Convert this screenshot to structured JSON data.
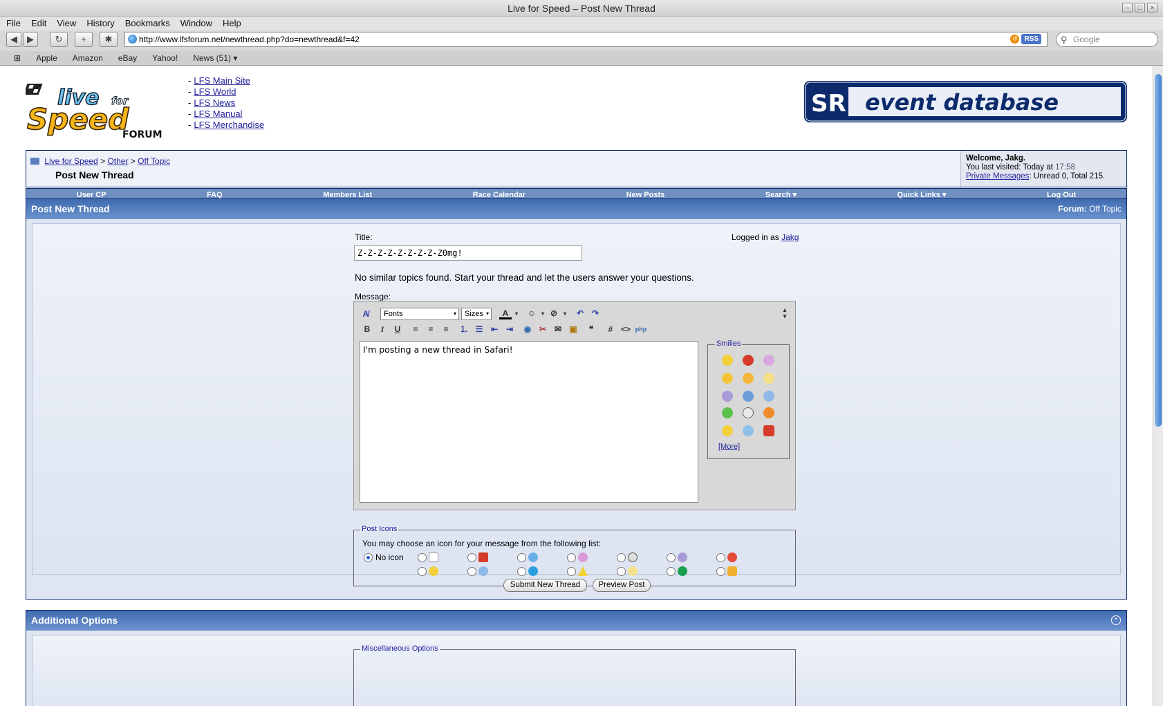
{
  "window": {
    "title": "Live for Speed – Post New Thread"
  },
  "menu": [
    "File",
    "Edit",
    "View",
    "History",
    "Bookmarks",
    "Window",
    "Help"
  ],
  "toolbar": {
    "url": "http://www.lfsforum.net/newthread.php?do=newthread&f=42",
    "rss_label": "RSS",
    "search_placeholder": "Google"
  },
  "bookmarks": [
    "Apple",
    "Amazon",
    "eBay",
    "Yahoo!",
    "News (51) ▾"
  ],
  "site_links": [
    "LFS Main Site",
    "LFS World",
    "LFS News",
    "LFS Manual",
    "LFS Merchandise"
  ],
  "logo": {
    "line1": "live for",
    "line2": "Speed",
    "line3": "FORUM"
  },
  "banner": {
    "badge": "SR",
    "text": "event database"
  },
  "breadcrumb": {
    "items": [
      "Live for Speed",
      "Other",
      "Off Topic"
    ],
    "separator": ">",
    "current": "Post New Thread"
  },
  "welcome": {
    "greeting": "Welcome, Jakg.",
    "last_visited_prefix": "You last visited: Today at",
    "last_visited_time": "17:58",
    "pm_label": "Private Messages",
    "pm_stats": ": Unread 0, Total 215."
  },
  "nav": [
    "User CP",
    "FAQ",
    "Members List",
    "Race Calendar",
    "New Posts",
    "Search ▾",
    "Quick Links ▾",
    "Log Out"
  ],
  "post_panel": {
    "heading": "Post New Thread",
    "forum_label": "Forum:",
    "forum_name": "Off Topic",
    "title_label": "Title:",
    "title_value": "Z-Z-Z-Z-Z-Z-Z-Z-Z0mg!",
    "logged_in_prefix": "Logged in as",
    "logged_in_user": "Jakg",
    "similar_text": "No similar topics found. Start your thread and let the users answer your questions.",
    "message_label": "Message:",
    "fonts_label": "Fonts",
    "sizes_label": "Sizes",
    "message_value": "I'm posting a new thread in Safari!",
    "smilies_legend": "Smilies",
    "more_label": "[More]",
    "post_icons_legend": "Post Icons",
    "post_icons_text": "You may choose an icon for your message from the following list:",
    "no_icon_label": "No icon",
    "submit_label": "Submit New Thread",
    "preview_label": "Preview Post"
  },
  "additional": {
    "heading": "Additional Options",
    "misc_legend": "Miscellaneous Options"
  },
  "colors": {
    "header_blue": "#3f6bb0",
    "navbar_blue": "#6f8fc3",
    "link": "#22229c"
  }
}
